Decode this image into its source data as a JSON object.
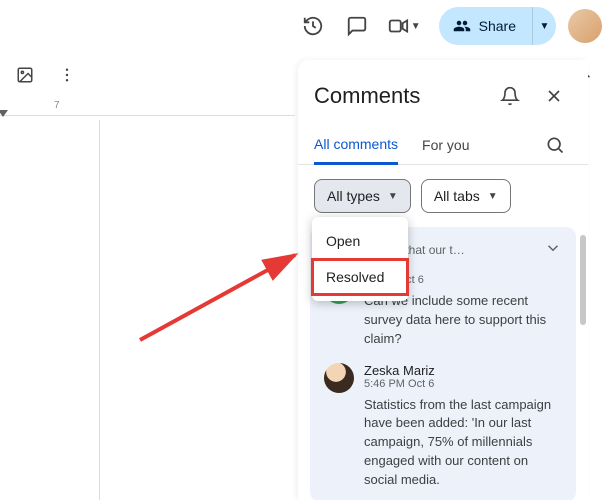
{
  "topbar": {
    "share_label": "Share"
  },
  "ruler": {
    "label7": "7"
  },
  "panel": {
    "title": "Comments",
    "tabs": {
      "all": "All comments",
      "for_you": "For you"
    },
    "filters": {
      "types": "All types",
      "tabs": "All tabs"
    },
    "dropdown": {
      "open": "Open",
      "resolved": "Resolved"
    },
    "thread": {
      "context": "sis shows that our t…",
      "entries": [
        {
          "name": "",
          "time": "… PM Oct 6",
          "body": "Can we include some recent survey data here to support this claim?"
        },
        {
          "name": "Zeska Mariz",
          "time": "5:46 PM Oct 6",
          "body": "Statistics from the last campaign have been added: 'In our last campaign, 75% of millennials engaged with our content on social media."
        }
      ]
    }
  }
}
